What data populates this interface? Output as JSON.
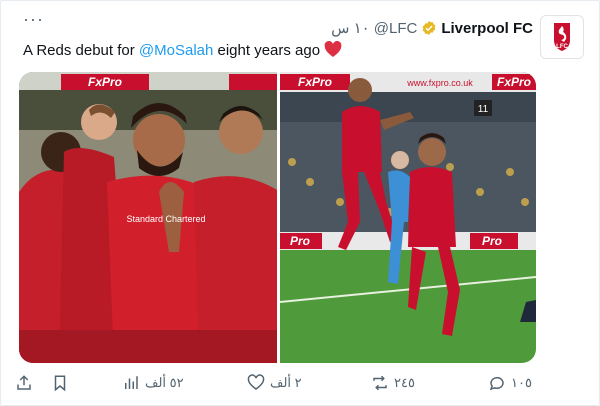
{
  "header": {
    "name": "Liverpool FC",
    "handle": "@LFC",
    "time": "١٠ س",
    "avatar_text": "LFC"
  },
  "tweet": {
    "text_before": "A Reds debut for ",
    "mention": "@MoSalah",
    "text_after": " eight years ago"
  },
  "media": {
    "ad1": "FxPro",
    "ad2": "FxPro",
    "ad3": "www.fxpro.co.uk",
    "ad4": "FxPro",
    "ad5": "Pro",
    "ad6": "Pro",
    "sponsor": "Standard Chartered",
    "scoreboard": "11"
  },
  "actions": {
    "replies": "١٠٥",
    "retweets": "٢٤٥",
    "likes": "٢ ألف",
    "views": "٥٢ ألف"
  },
  "colors": {
    "link": "#1d9bf0",
    "heart": "#f91880",
    "lfc_red": "#c8102e",
    "verified": "#e8b923"
  }
}
